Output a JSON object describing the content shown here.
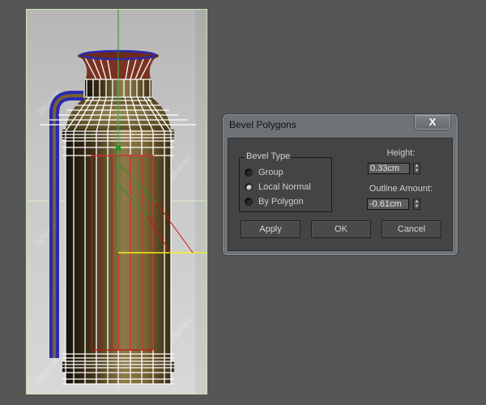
{
  "viewport": {
    "label": "3D viewport",
    "watermark": "3dsmax",
    "colors": {
      "border": "#c8e6b0",
      "wire": "#ffffff",
      "selected_wire": "#2a2ab0",
      "selected_faces": "#cc1111",
      "gizmo_y": "#1a9a1a",
      "gizmo_x": "#f0f020",
      "gizmo_diag": "#cc1111"
    }
  },
  "dialog": {
    "title": "Bevel Polygons",
    "close_label": "X",
    "bevel_type": {
      "label": "Bevel Type",
      "options": [
        {
          "label": "Group",
          "checked": false
        },
        {
          "label": "Local Normal",
          "checked": true
        },
        {
          "label": "By Polygon",
          "checked": false
        }
      ]
    },
    "height": {
      "label": "Height:",
      "value": "0.33cm"
    },
    "outline": {
      "label": "Outline Amount:",
      "value": "-0.61cm"
    },
    "buttons": {
      "apply": "Apply",
      "ok": "OK",
      "cancel": "Cancel"
    }
  }
}
